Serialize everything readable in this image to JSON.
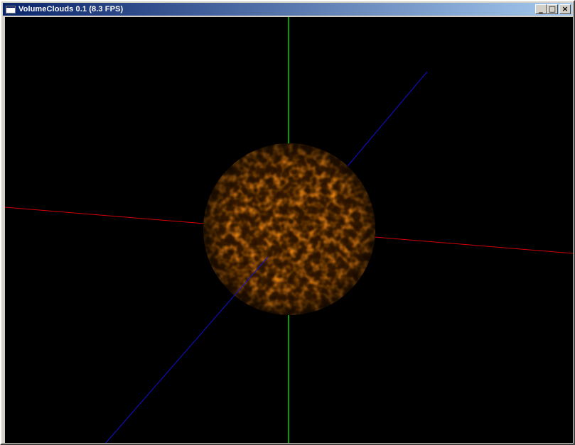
{
  "window": {
    "title": "VolumeClouds 0.1 (8.3 FPS)",
    "icon": "application-window-icon",
    "controls": {
      "minimize": {
        "icon": "minimize-icon",
        "glyph": "_"
      },
      "maximize": {
        "icon": "maximize-icon",
        "glyph": "□"
      },
      "close": {
        "icon": "close-icon",
        "glyph": "×"
      }
    }
  },
  "scene": {
    "background": "#000000",
    "axes": {
      "x": {
        "color": "#d40000"
      },
      "y": {
        "color": "#00a000"
      },
      "z": {
        "color": "#1010d0"
      }
    },
    "sphere": {
      "texture": "orange cellular cloud noise",
      "colors": [
        "#2a1200",
        "#7a3a05",
        "#e07a10",
        "#ffb040"
      ]
    }
  }
}
